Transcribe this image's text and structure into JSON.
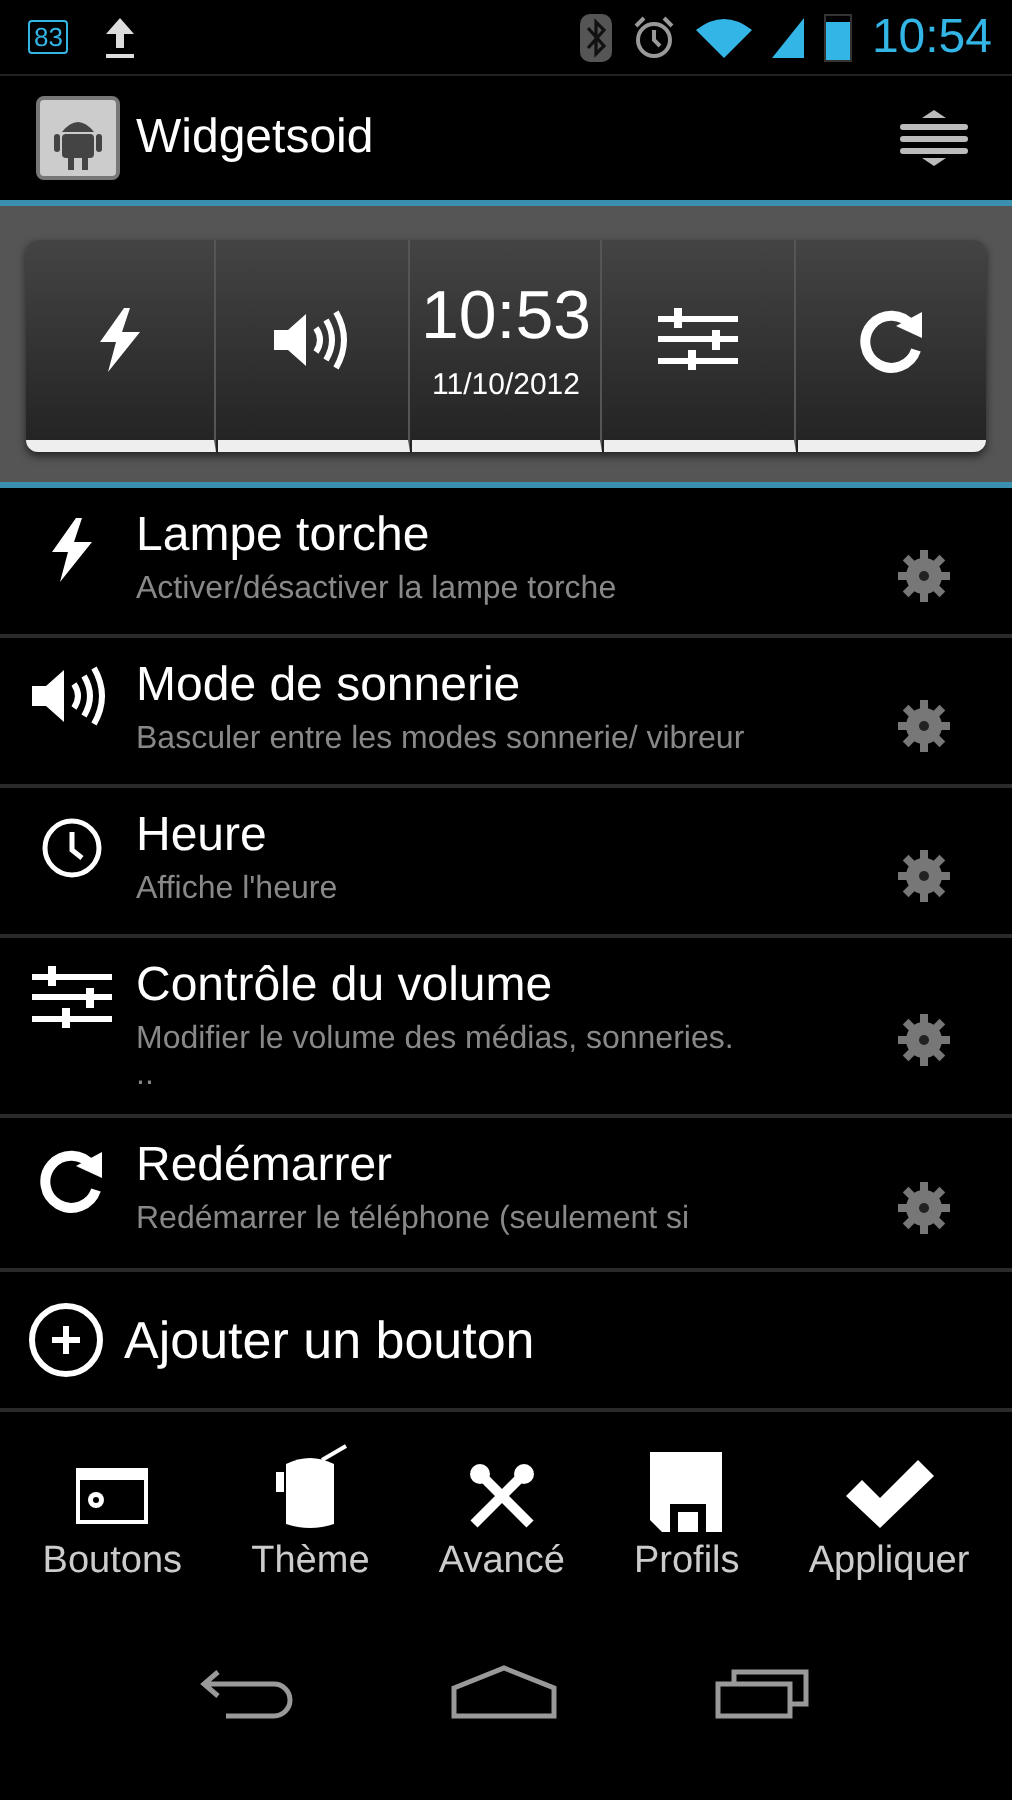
{
  "status_bar": {
    "notification_count": "83",
    "time": "10:54"
  },
  "app_bar": {
    "title": "Widgetsoid"
  },
  "widget_preview": [
    {
      "kind": "flash"
    },
    {
      "kind": "sound"
    },
    {
      "kind": "clock",
      "time": "10:53",
      "date": "11/10/2012"
    },
    {
      "kind": "sliders"
    },
    {
      "kind": "refresh"
    }
  ],
  "buttons_list": [
    {
      "kind": "flash",
      "title": "Lampe torche",
      "description": "Activer/désactiver la lampe torche"
    },
    {
      "kind": "sound",
      "title": "Mode de sonnerie",
      "description": "Basculer entre les modes sonnerie/ vibreur"
    },
    {
      "kind": "clock",
      "title": "Heure",
      "description": "Affiche l'heure"
    },
    {
      "kind": "sliders",
      "title": "Contrôle du volume",
      "description": "Modifier le volume des médias, sonneries. .."
    },
    {
      "kind": "refresh",
      "title": "Redémarrer",
      "description": "Redémarrer le téléphone (seulement si"
    }
  ],
  "add_button": {
    "label": "Ajouter un bouton"
  },
  "bottom_bar": [
    {
      "kind": "window",
      "label": "Boutons"
    },
    {
      "kind": "bucket",
      "label": "Thème"
    },
    {
      "kind": "tools",
      "label": "Avancé"
    },
    {
      "kind": "floppy",
      "label": "Profils"
    },
    {
      "kind": "check",
      "label": "Appliquer"
    }
  ]
}
